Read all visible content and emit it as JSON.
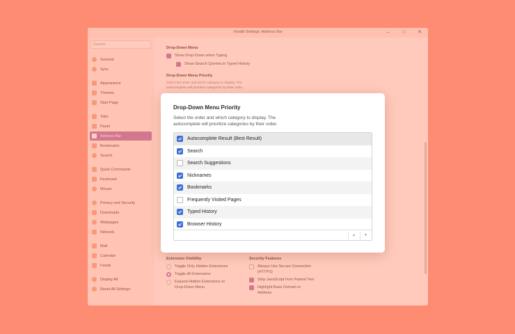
{
  "window": {
    "title": "Vivaldi Settings: Address Bar",
    "minimize": "–",
    "maximize": "□",
    "close": "✕"
  },
  "sidebar": {
    "search_placeholder": "Search",
    "items": [
      {
        "label": "General",
        "icon": "gear-icon"
      },
      {
        "label": "Sync",
        "icon": "cloud-icon"
      },
      {
        "label": "Appearance",
        "icon": "appearance-icon"
      },
      {
        "label": "Themes",
        "icon": "brush-icon"
      },
      {
        "label": "Start Page",
        "icon": "grid-icon"
      },
      {
        "label": "Tabs",
        "icon": "tabs-icon"
      },
      {
        "label": "Panel",
        "icon": "panel-icon"
      },
      {
        "label": "Address Bar",
        "icon": "address-bar-icon"
      },
      {
        "label": "Bookmarks",
        "icon": "bookmark-icon"
      },
      {
        "label": "Search",
        "icon": "search-icon"
      },
      {
        "label": "Quick Commands",
        "icon": "quick-commands-icon"
      },
      {
        "label": "Keyboard",
        "icon": "keyboard-icon"
      },
      {
        "label": "Mouse",
        "icon": "mouse-icon"
      },
      {
        "label": "Privacy and Security",
        "icon": "shield-icon"
      },
      {
        "label": "Downloads",
        "icon": "download-icon"
      },
      {
        "label": "Webpages",
        "icon": "globe-icon"
      },
      {
        "label": "Network",
        "icon": "network-icon"
      },
      {
        "label": "Mail",
        "icon": "mail-icon"
      },
      {
        "label": "Calendar",
        "icon": "calendar-icon"
      },
      {
        "label": "Feeds",
        "icon": "rss-icon"
      },
      {
        "label": "Display All",
        "icon": "display-all-icon"
      },
      {
        "label": "Reset All Settings",
        "icon": "power-icon"
      }
    ],
    "selected": "Address Bar"
  },
  "main": {
    "dropdown_heading": "Drop-Down Menu",
    "show_dropdown": "Show Drop-Down when Typing",
    "show_queries": "Show Search Queries in Typed History",
    "priority_heading": "Drop-Down Menu Priority",
    "priority_desc_1": "Select the order and which category to display. The",
    "priority_desc_2": "autocomplete will prioritize categories by their order.",
    "ext_heading": "Extension Visibility",
    "ext_options": [
      "Toggle Only Hidden Extensions",
      "Toggle All Extensions",
      "Expand Hidden Extensions to",
      "Drop-Down Menu"
    ],
    "sec_heading": "Security Features",
    "sec_options": [
      "Always Use Secure Connection",
      "(HTTPS)",
      "Strip JavaScript from Pasted Text",
      "Highlight Base Domain in",
      "Address"
    ]
  },
  "dialog": {
    "title": "Drop-Down Menu Priority",
    "desc_1": "Select the order and which category to display. The",
    "desc_2": "autocomplete will prioritize categories by their order.",
    "items": [
      {
        "label": "Autocomplete Result (Best Result)",
        "checked": true
      },
      {
        "label": "Search",
        "checked": true
      },
      {
        "label": "Search Suggestions",
        "checked": false
      },
      {
        "label": "Nicknames",
        "checked": true
      },
      {
        "label": "Bookmarks",
        "checked": true
      },
      {
        "label": "Frequently Visited Pages",
        "checked": false
      },
      {
        "label": "Typed History",
        "checked": true
      },
      {
        "label": "Browser History",
        "checked": true
      }
    ],
    "move_up": "▲",
    "move_down": "▼"
  },
  "colors": {
    "background": "#fe8c72",
    "accent": "#b06aa5",
    "checkbox_blue": "#3d6fd4"
  }
}
